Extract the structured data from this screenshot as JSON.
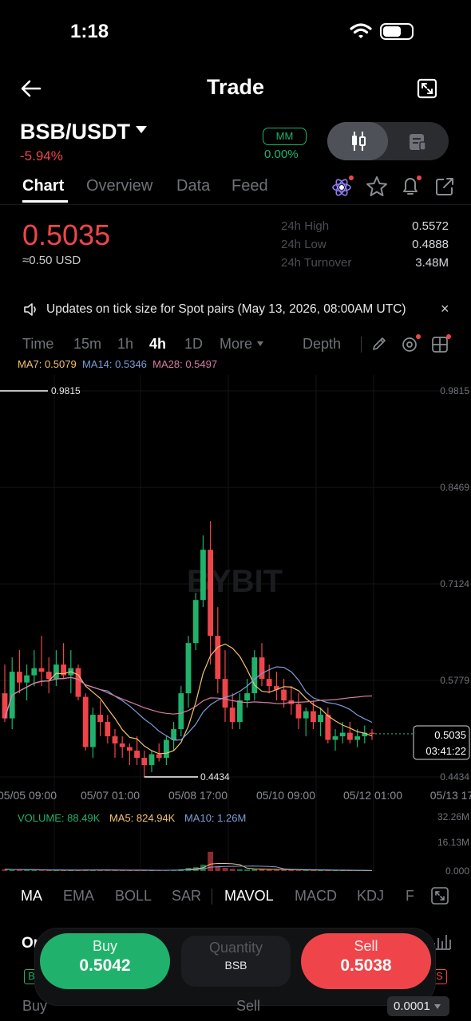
{
  "status_bar": {
    "time": "1:18"
  },
  "header": {
    "title": "Trade"
  },
  "pair": {
    "symbol": "BSB/USDT",
    "change": "-5.94%",
    "mm_label": "MM",
    "mm_value": "0.00%"
  },
  "tabs": [
    "Chart",
    "Overview",
    "Data",
    "Feed"
  ],
  "price": {
    "last": "0.5035",
    "usd": "≈0.50 USD",
    "stats": [
      {
        "label": "24h High",
        "value": "0.5572"
      },
      {
        "label": "24h Low",
        "value": "0.4888"
      },
      {
        "label": "24h Turnover",
        "value": "3.48M"
      }
    ]
  },
  "notice": {
    "text": "Updates on tick size for Spot pairs (May 13, 2026, 08:00AM UTC)",
    "close": "×"
  },
  "intervals": {
    "items": [
      "Time",
      "15m",
      "1h",
      "4h",
      "1D",
      "More"
    ],
    "active": "4h",
    "depth": "Depth"
  },
  "ma_legend": {
    "ma7": "MA7: 0.5079",
    "ma14": "MA14: 0.5346",
    "ma28": "MA28: 0.5497"
  },
  "volume_legend": {
    "volume": "VOLUME: 88.49K",
    "ma5": "MA5: 824.94K",
    "ma10": "MA10: 1.26M"
  },
  "chart_data": {
    "type": "candlestick",
    "watermark": "BYBIT",
    "y_axis": [
      "0.9815",
      "0.8469",
      "0.7124",
      "0.5779",
      "0.4434"
    ],
    "ylim": [
      0.4434,
      0.9815
    ],
    "x_labels": [
      "05/05 09:00",
      "05/07 01:00",
      "05/08 17:00",
      "05/10 09:00",
      "05/12 01:00",
      "05/13 17"
    ],
    "high_marker": "0.9815",
    "low_marker": "0.4434",
    "current_price": "0.5035",
    "countdown": "03:41:22",
    "volume_axis": [
      "32.26M",
      "16.13M",
      "0.000"
    ],
    "volume_max": 32.26,
    "colors": {
      "up": "#20b26c",
      "down": "#ef454a",
      "ma7": "#f5c26b",
      "ma14": "#7c9fd8",
      "ma28": "#d77ea5"
    },
    "candles": [
      [
        0.56,
        0.6,
        0.52,
        0.525,
        1.5
      ],
      [
        0.525,
        0.61,
        0.51,
        0.59,
        1.0
      ],
      [
        0.59,
        0.62,
        0.56,
        0.575,
        1.1
      ],
      [
        0.575,
        0.6,
        0.55,
        0.585,
        0.9
      ],
      [
        0.585,
        0.62,
        0.57,
        0.595,
        0.8
      ],
      [
        0.595,
        0.64,
        0.57,
        0.59,
        0.7
      ],
      [
        0.59,
        0.61,
        0.56,
        0.58,
        0.6
      ],
      [
        0.58,
        0.62,
        0.57,
        0.6,
        0.8
      ],
      [
        0.6,
        0.63,
        0.58,
        0.585,
        0.6
      ],
      [
        0.585,
        0.62,
        0.56,
        0.595,
        0.7
      ],
      [
        0.595,
        0.6,
        0.55,
        0.555,
        0.8
      ],
      [
        0.555,
        0.56,
        0.48,
        0.485,
        1.2
      ],
      [
        0.485,
        0.54,
        0.47,
        0.53,
        0.9
      ],
      [
        0.53,
        0.55,
        0.5,
        0.52,
        0.7
      ],
      [
        0.52,
        0.53,
        0.49,
        0.5,
        0.6
      ],
      [
        0.5,
        0.51,
        0.47,
        0.49,
        0.7
      ],
      [
        0.49,
        0.5,
        0.47,
        0.485,
        0.6
      ],
      [
        0.485,
        0.49,
        0.46,
        0.48,
        0.5
      ],
      [
        0.48,
        0.5,
        0.46,
        0.47,
        0.6
      ],
      [
        0.47,
        0.48,
        0.443,
        0.46,
        0.7
      ],
      [
        0.46,
        0.48,
        0.45,
        0.475,
        0.5
      ],
      [
        0.475,
        0.49,
        0.465,
        0.47,
        0.6
      ],
      [
        0.47,
        0.5,
        0.46,
        0.495,
        0.7
      ],
      [
        0.495,
        0.52,
        0.48,
        0.51,
        0.8
      ],
      [
        0.51,
        0.57,
        0.5,
        0.56,
        1.5
      ],
      [
        0.56,
        0.64,
        0.54,
        0.63,
        2.5
      ],
      [
        0.63,
        0.7,
        0.62,
        0.69,
        3.0
      ],
      [
        0.69,
        0.78,
        0.68,
        0.76,
        5.0
      ],
      [
        0.76,
        0.8,
        0.6,
        0.64,
        15.0
      ],
      [
        0.64,
        0.68,
        0.56,
        0.58,
        4.0
      ],
      [
        0.58,
        0.62,
        0.52,
        0.54,
        2.5
      ],
      [
        0.54,
        0.56,
        0.51,
        0.52,
        1.8
      ],
      [
        0.52,
        0.56,
        0.51,
        0.55,
        1.5
      ],
      [
        0.55,
        0.58,
        0.54,
        0.56,
        1.3
      ],
      [
        0.56,
        0.62,
        0.55,
        0.61,
        1.6
      ],
      [
        0.61,
        0.63,
        0.57,
        0.58,
        1.5
      ],
      [
        0.58,
        0.6,
        0.56,
        0.57,
        1.2
      ],
      [
        0.57,
        0.59,
        0.55,
        0.565,
        1.0
      ],
      [
        0.565,
        0.58,
        0.54,
        0.55,
        1.1
      ],
      [
        0.55,
        0.57,
        0.53,
        0.545,
        0.9
      ],
      [
        0.545,
        0.56,
        0.51,
        0.525,
        0.8
      ],
      [
        0.525,
        0.54,
        0.5,
        0.535,
        0.6
      ],
      [
        0.535,
        0.55,
        0.51,
        0.52,
        0.7
      ],
      [
        0.52,
        0.54,
        0.5,
        0.53,
        0.6
      ],
      [
        0.53,
        0.54,
        0.49,
        0.495,
        0.7
      ],
      [
        0.495,
        0.51,
        0.48,
        0.5,
        0.5
      ],
      [
        0.5,
        0.52,
        0.49,
        0.505,
        0.4
      ],
      [
        0.505,
        0.52,
        0.49,
        0.495,
        0.4
      ],
      [
        0.495,
        0.51,
        0.485,
        0.5,
        0.3
      ],
      [
        0.5,
        0.515,
        0.49,
        0.505,
        0.3
      ],
      [
        0.505,
        0.51,
        0.495,
        0.5035,
        0.1
      ]
    ]
  },
  "indicators": [
    "MA",
    "EMA",
    "BOLL",
    "SAR",
    "MAVOL",
    "MACD",
    "KDJ",
    "F"
  ],
  "order_peek": "Or",
  "bottom": {
    "buy_label": "Buy",
    "buy_price": "0.5042",
    "qty_label": "Quantity",
    "qty_unit": "BSB",
    "sell_label": "Sell",
    "sell_price": "0.5038",
    "b_tag": "B",
    "s_tag": "S"
  },
  "footer": {
    "buy": "Buy",
    "sell": "Sell",
    "precision": "0.0001"
  }
}
